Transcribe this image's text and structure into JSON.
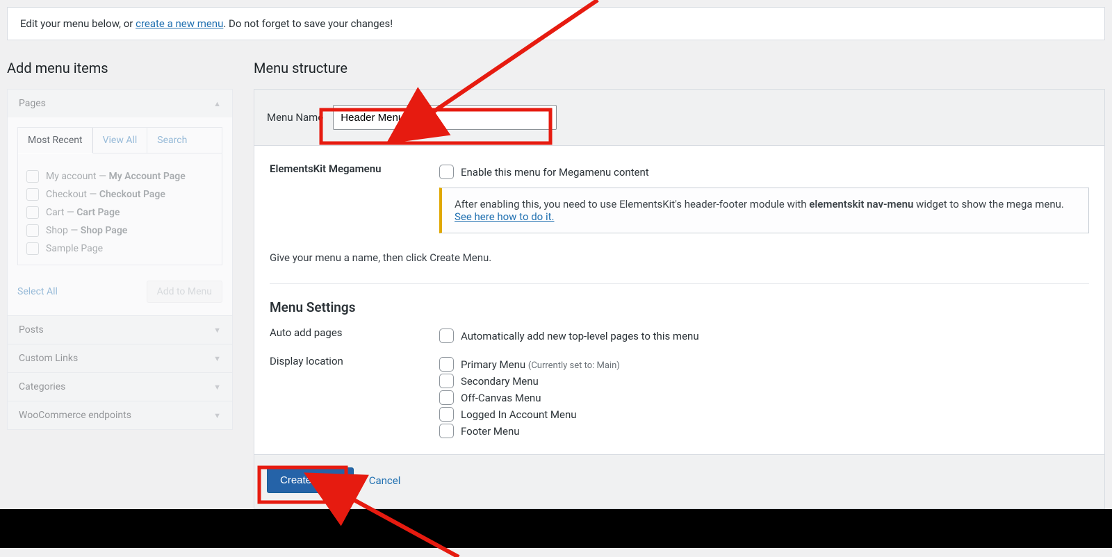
{
  "info_bar": {
    "prefix": "Edit your menu below, or ",
    "link": "create a new menu",
    "suffix": ". Do not forget to save your changes!"
  },
  "left": {
    "title": "Add menu items",
    "pages": {
      "head": "Pages",
      "tabs": {
        "recent": "Most Recent",
        "all": "View All",
        "search": "Search"
      },
      "items": [
        {
          "pre": "My account — ",
          "strong": "My Account Page"
        },
        {
          "pre": "Checkout — ",
          "strong": "Checkout Page"
        },
        {
          "pre": "Cart — ",
          "strong": "Cart Page"
        },
        {
          "pre": "Shop — ",
          "strong": "Shop Page"
        },
        {
          "pre": "Sample Page",
          "strong": ""
        }
      ],
      "select_all": "Select All",
      "add_btn": "Add to Menu"
    },
    "others": [
      "Posts",
      "Custom Links",
      "Categories",
      "WooCommerce endpoints"
    ]
  },
  "right": {
    "title": "Menu structure",
    "menu_name_label": "Menu Name",
    "menu_name_value": "Header Menu",
    "mega": {
      "label": "ElementsKit Megamenu",
      "checkbox": "Enable this menu for Megamenu content",
      "note_pre": "After enabling this, you need to use ElementsKit's header-footer module with ",
      "note_strong": "elementskit nav-menu",
      "note_post": " widget to show the mega menu. ",
      "note_link": "See here how to do it."
    },
    "hint": "Give your menu a name, then click Create Menu.",
    "settings_title": "Menu Settings",
    "auto_add": {
      "label": "Auto add pages",
      "checkbox": "Automatically add new top-level pages to this menu"
    },
    "display": {
      "label": "Display location",
      "options": [
        {
          "text": "Primary Menu",
          "note": "(Currently set to: Main)"
        },
        {
          "text": "Secondary Menu",
          "note": ""
        },
        {
          "text": "Off-Canvas Menu",
          "note": ""
        },
        {
          "text": "Logged In Account Menu",
          "note": ""
        },
        {
          "text": "Footer Menu",
          "note": ""
        }
      ]
    },
    "create_btn": "Create Menu",
    "cancel": "Cancel"
  },
  "annotations": {
    "highlight_color": "#e61b10"
  }
}
